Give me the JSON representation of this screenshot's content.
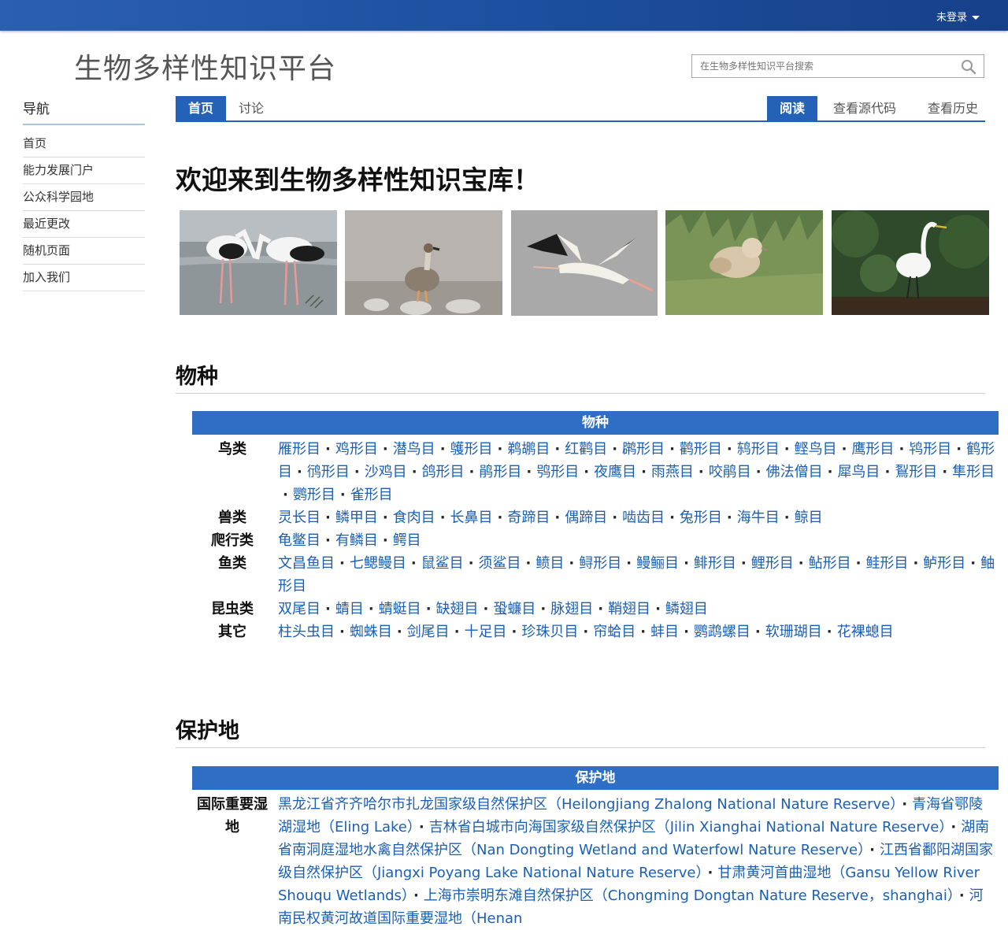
{
  "topbar": {
    "login_label": "未登录"
  },
  "site": {
    "title": "生物多样性知识平台"
  },
  "search": {
    "placeholder": "在生物多样性知识平台搜索"
  },
  "nav": {
    "heading": "导航",
    "items": [
      "首页",
      "能力发展门户",
      "公众科学园地",
      "最近更改",
      "随机页面",
      "加入我们"
    ]
  },
  "tabs": {
    "left": [
      "首页",
      "讨论"
    ],
    "right": [
      "阅读",
      "查看源代码",
      "查看历史"
    ]
  },
  "page": {
    "heading": "欢迎来到生物多样性知识宝库！"
  },
  "photos": [
    "white-storks-photo",
    "swan-goose-photo",
    "siberian-crane-photo",
    "finch-photo",
    "egret-photo"
  ],
  "species": {
    "section_title": "物种",
    "box_title": "物种",
    "rows": [
      {
        "label": "鸟类",
        "items": [
          "雁形目",
          "鸡形目",
          "潜鸟目",
          "鹱形目",
          "鹈鹕目",
          "红鹳目",
          "䴙形目",
          "鹳形目",
          "鸫形目",
          "鲣鸟目",
          "鹰形目",
          "鸨形目",
          "鹤形目",
          "鸻形目",
          "沙鸡目",
          "鸽形目",
          "鹃形目",
          "鸮形目",
          "夜鹰目",
          "雨燕目",
          "咬鹃目",
          "佛法僧目",
          "犀鸟目",
          "鴷形目",
          "隼形目",
          "鹦形目",
          "雀形目"
        ]
      },
      {
        "label": "兽类",
        "items": [
          "灵长目",
          "鳞甲目",
          "食肉目",
          "长鼻目",
          "奇蹄目",
          "偶蹄目",
          "啮齿目",
          "兔形目",
          "海牛目",
          "鲸目"
        ]
      },
      {
        "label": "爬行类",
        "items": [
          "龟鳖目",
          "有鳞目",
          "鳄目"
        ]
      },
      {
        "label": "鱼类",
        "items": [
          "文昌鱼目",
          "七鳃鳗目",
          "鼠鲨目",
          "须鲨目",
          "鲼目",
          "鲟形目",
          "鳗鲡目",
          "鲱形目",
          "鲤形目",
          "鲇形目",
          "鲑形目",
          "鲈形目",
          "鲉形目"
        ]
      },
      {
        "label": "昆虫类",
        "items": [
          "双尾目",
          "蜻目",
          "蜻蜓目",
          "缺翅目",
          "蛩蠊目",
          "脉翅目",
          "鞘翅目",
          "鳞翅目"
        ]
      },
      {
        "label": "其它",
        "items": [
          "柱头虫目",
          "蜘蛛目",
          "剑尾目",
          "十足目",
          "珍珠贝目",
          "帘蛤目",
          "蚌目",
          "鹦鹉螺目",
          "软珊瑚目",
          "花裸螅目"
        ]
      }
    ]
  },
  "reserves": {
    "section_title": "保护地",
    "box_title": "保护地",
    "rows": [
      {
        "label": "国际重要湿地",
        "items": [
          "黑龙江省齐齐哈尔市扎龙国家级自然保护区（Heilongjiang Zhalong National Nature Reserve）",
          "青海省鄂陵湖湿地（Eling Lake）",
          "吉林省白城市向海国家级自然保护区（Jilin Xianghai National Nature Reserve）",
          "湖南省南洞庭湿地水禽自然保护区（Nan Dongting Wetland and Waterfowl Nature Reserve）",
          "江西省鄱阳湖国家级自然保护区（Jiangxi Poyang Lake National Nature Reserve）",
          "甘肃黄河首曲湿地（Gansu Yellow River Shouqu Wetlands）",
          "上海市崇明东滩自然保护区（Chongming Dongtan Nature Reserve，shanghai）",
          "河南民权黄河故道国际重要湿地（Henan"
        ]
      }
    ]
  },
  "colors": {
    "topbar": "#1e4fa0",
    "accent": "#2462b8",
    "link": "#1a5fb4",
    "box_header": "#2e6ec4"
  }
}
